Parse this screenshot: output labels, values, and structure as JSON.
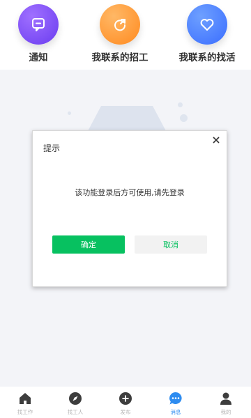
{
  "shortcuts": [
    {
      "label": "通知",
      "icon": "message-square-icon"
    },
    {
      "label": "我联系的招工",
      "icon": "refresh-arrow-icon"
    },
    {
      "label": "我联系的找活",
      "icon": "heart-icon"
    }
  ],
  "dialog": {
    "title": "提示",
    "message": "该功能登录后方可使用,请先登录",
    "confirm_label": "确定",
    "cancel_label": "取消",
    "close_icon": "close-icon"
  },
  "tabbar": {
    "items": [
      {
        "label": "找工作",
        "icon": "home-icon"
      },
      {
        "label": "找工人",
        "icon": "compass-icon"
      },
      {
        "label": "发布",
        "icon": "plus-circle-icon"
      },
      {
        "label": "消息",
        "icon": "chat-bubble-icon",
        "active": true
      },
      {
        "label": "我的",
        "icon": "user-icon"
      }
    ]
  },
  "colors": {
    "primary_green": "#07c160",
    "active_blue": "#2d8cf0",
    "notice_purple": "#7b4dff",
    "hire_orange": "#ff9a3c",
    "job_blue": "#4a7bff"
  }
}
